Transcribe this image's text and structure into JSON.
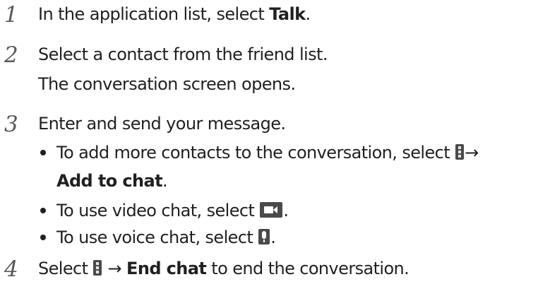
{
  "steps": [
    {
      "num": "1",
      "pre": "In the application list, select ",
      "bold": "Talk",
      "post": "."
    },
    {
      "num": "2",
      "line1": "Select a contact from the friend list.",
      "line2": "The conversation screen opens."
    },
    {
      "num": "3",
      "text": "Enter and send your message.",
      "bullets": [
        {
          "pre": "To add more contacts to the conversation, select ",
          "icon": "menu-icon",
          "arrow": "→",
          "bold": "Add to chat",
          "post": "."
        },
        {
          "pre": "To use video chat, select ",
          "icon": "video-chat-icon",
          "post": "."
        },
        {
          "pre": "To use voice chat, select ",
          "icon": "microphone-icon",
          "post": "."
        }
      ]
    },
    {
      "num": "4",
      "pre": "Select ",
      "icon": "menu-icon",
      "arrow": " → ",
      "bold": "End chat",
      "post": " to end the conversation."
    }
  ]
}
